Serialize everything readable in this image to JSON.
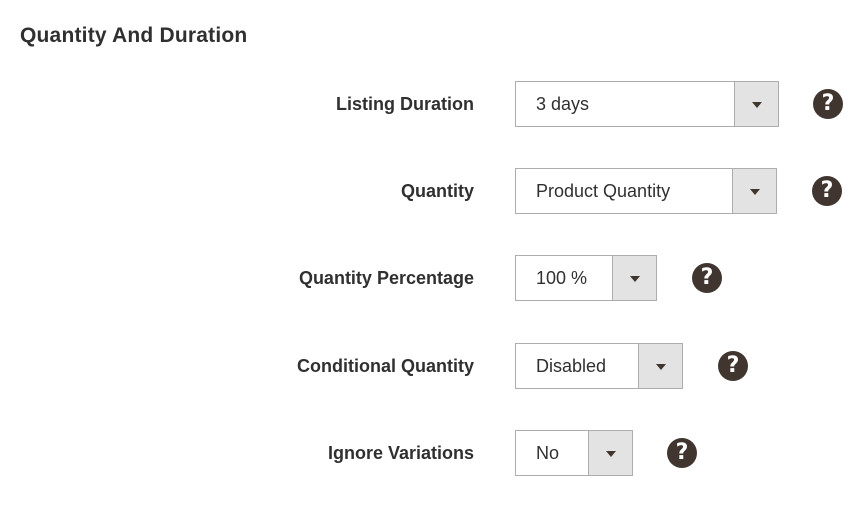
{
  "section": {
    "title": "Quantity And Duration"
  },
  "fields": [
    {
      "label": "Listing Duration",
      "value": "3 days",
      "help_icon": "question-circle-icon"
    },
    {
      "label": "Quantity",
      "value": "Product Quantity",
      "help_icon": "question-circle-icon"
    },
    {
      "label": "Quantity Percentage",
      "value": "100 %",
      "help_icon": "question-circle-icon"
    },
    {
      "label": "Conditional Quantity",
      "value": "Disabled",
      "help_icon": "question-circle-icon"
    },
    {
      "label": "Ignore Variations",
      "value": "No",
      "help_icon": "question-circle-icon"
    }
  ],
  "help_glyph": "?",
  "colors": {
    "text": "#303030",
    "border": "#adadad",
    "arrow_bg": "#e3e3e3",
    "icon_bg": "#41362f"
  }
}
